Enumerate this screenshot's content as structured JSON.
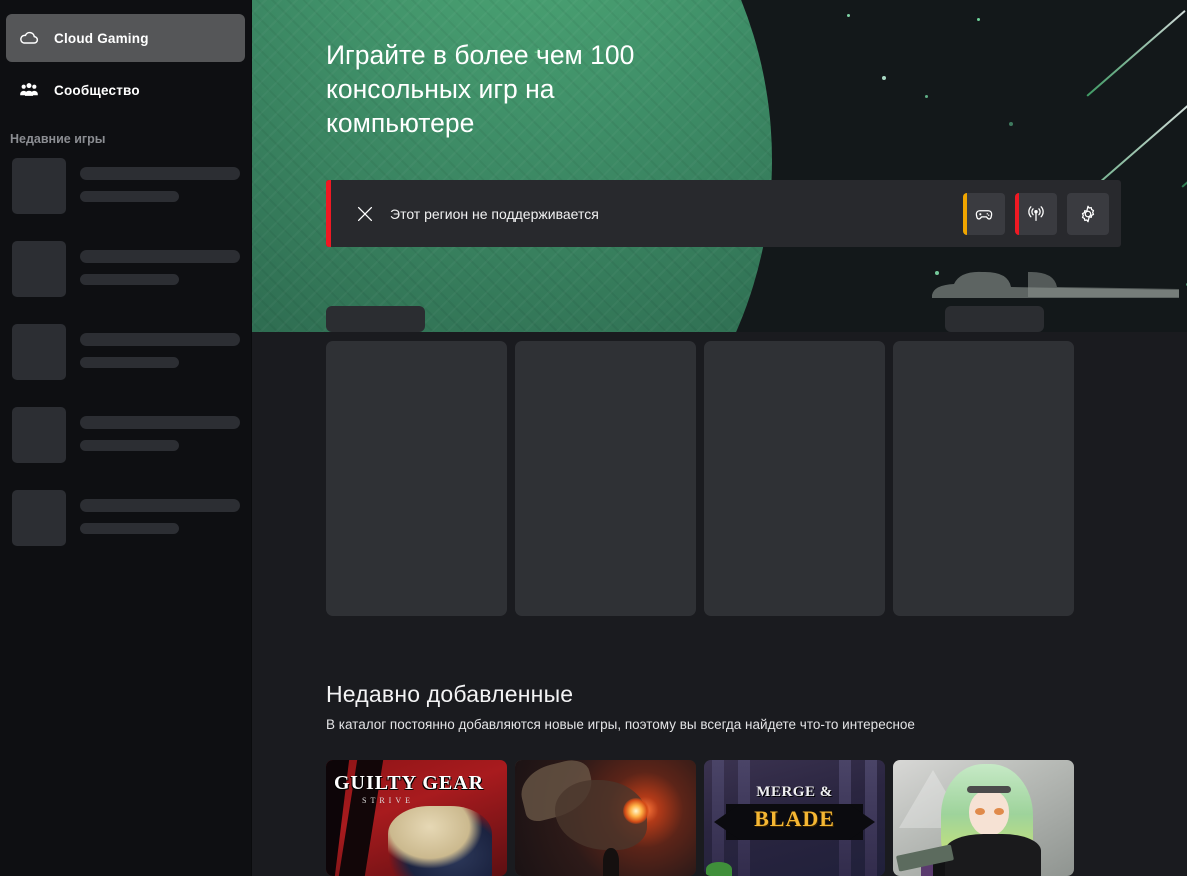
{
  "sidebar": {
    "nav": [
      {
        "label": "Cloud Gaming",
        "icon": "cloud-icon",
        "active": true
      },
      {
        "label": "Сообщество",
        "icon": "people-group-icon",
        "active": false
      }
    ],
    "section_label": "Недавние игры",
    "skeleton_items": 5
  },
  "hero": {
    "title": "Играйте в более чем 100\nконсольных игр на\nкомпьютере",
    "plus_mark": "+",
    "accent_green": "#4faa77"
  },
  "banner": {
    "message": "Этот регион не поддерживается",
    "close_icon": "close-x-icon",
    "accent_color": "#ef1923",
    "actions": [
      {
        "icon": "gamepad-icon",
        "name": "gamepad-button",
        "indicator": "#f0a500"
      },
      {
        "icon": "signal-broadcast-icon",
        "name": "network-button",
        "indicator": "#ef1923"
      },
      {
        "icon": "gear-icon",
        "name": "settings-button",
        "indicator": ""
      }
    ]
  },
  "skeleton_carousel": {
    "cards": 4
  },
  "recent": {
    "title": "Недавно добавленные",
    "subtitle": "В каталог постоянно добавляются новые игры, поэтому вы всегда найдете что-то интересное",
    "chevron_icon": "chevron-right-icon",
    "cards": [
      {
        "name": "guilty-gear-strive",
        "title_main": "GUILTY GEAR",
        "title_sub": "STRIVE",
        "art": "gg"
      },
      {
        "name": "eldritch-creature-game",
        "title_main": "",
        "title_sub": "",
        "art": "el"
      },
      {
        "name": "merge-and-blade",
        "title_main": "MERGE &",
        "title_sub": "BLADE",
        "art": "mb"
      },
      {
        "name": "anime-character-game",
        "title_main": "",
        "title_sub": "",
        "art": "an"
      }
    ]
  },
  "colors": {
    "bg": "#1a1b1f",
    "sidebar_bg": "#0e0f12",
    "active_nav": "#555658",
    "skeleton": "#2c2e33"
  }
}
